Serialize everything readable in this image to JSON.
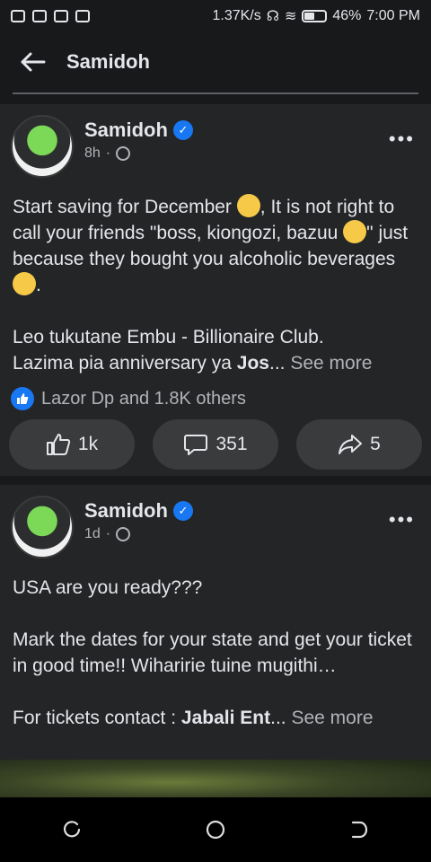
{
  "status_bar": {
    "speed": "1.37K/s",
    "battery": "46%",
    "time": "7:00 PM"
  },
  "app_bar": {
    "title": "Samidoh"
  },
  "posts": [
    {
      "author": "Samidoh",
      "time": "8h",
      "text_lines": [
        "Start saving for December",
        ", It is not right to call your friends \"boss, kiongozi, bazuu",
        "\" just because they bought you alcoholic  beverages",
        "."
      ],
      "para2_a": "Leo tukutane Embu - Billionaire Club.",
      "para2_b": "Lazima pia anniversary ya ",
      "para2_bold": "Jos",
      "ellipsis": "...",
      "see_more": "See more",
      "reactions_text": "Lazor Dp and 1.8K others",
      "likes": "1k",
      "comments": "351",
      "shares": "5"
    },
    {
      "author": "Samidoh",
      "time": "1d",
      "line1": "USA are you ready???",
      "para2": "Mark the dates for your state and get your ticket in good time!! Wiharirie tuine mugithi…",
      "para3_a": "For tickets contact : ",
      "para3_bold": "Jabali Ent",
      "ellipsis": "...",
      "see_more": "See more"
    }
  ],
  "icons": {
    "back": "arrow-left-icon",
    "verified": "verified-badge-icon",
    "privacy": "globe-icon",
    "more": "more-options-icon",
    "like": "thumbs-up-icon",
    "comment": "comment-icon",
    "share": "share-icon"
  },
  "colors": {
    "background": "#18191a",
    "card": "#242526",
    "accent": "#1877f2",
    "button": "#3a3b3c"
  }
}
